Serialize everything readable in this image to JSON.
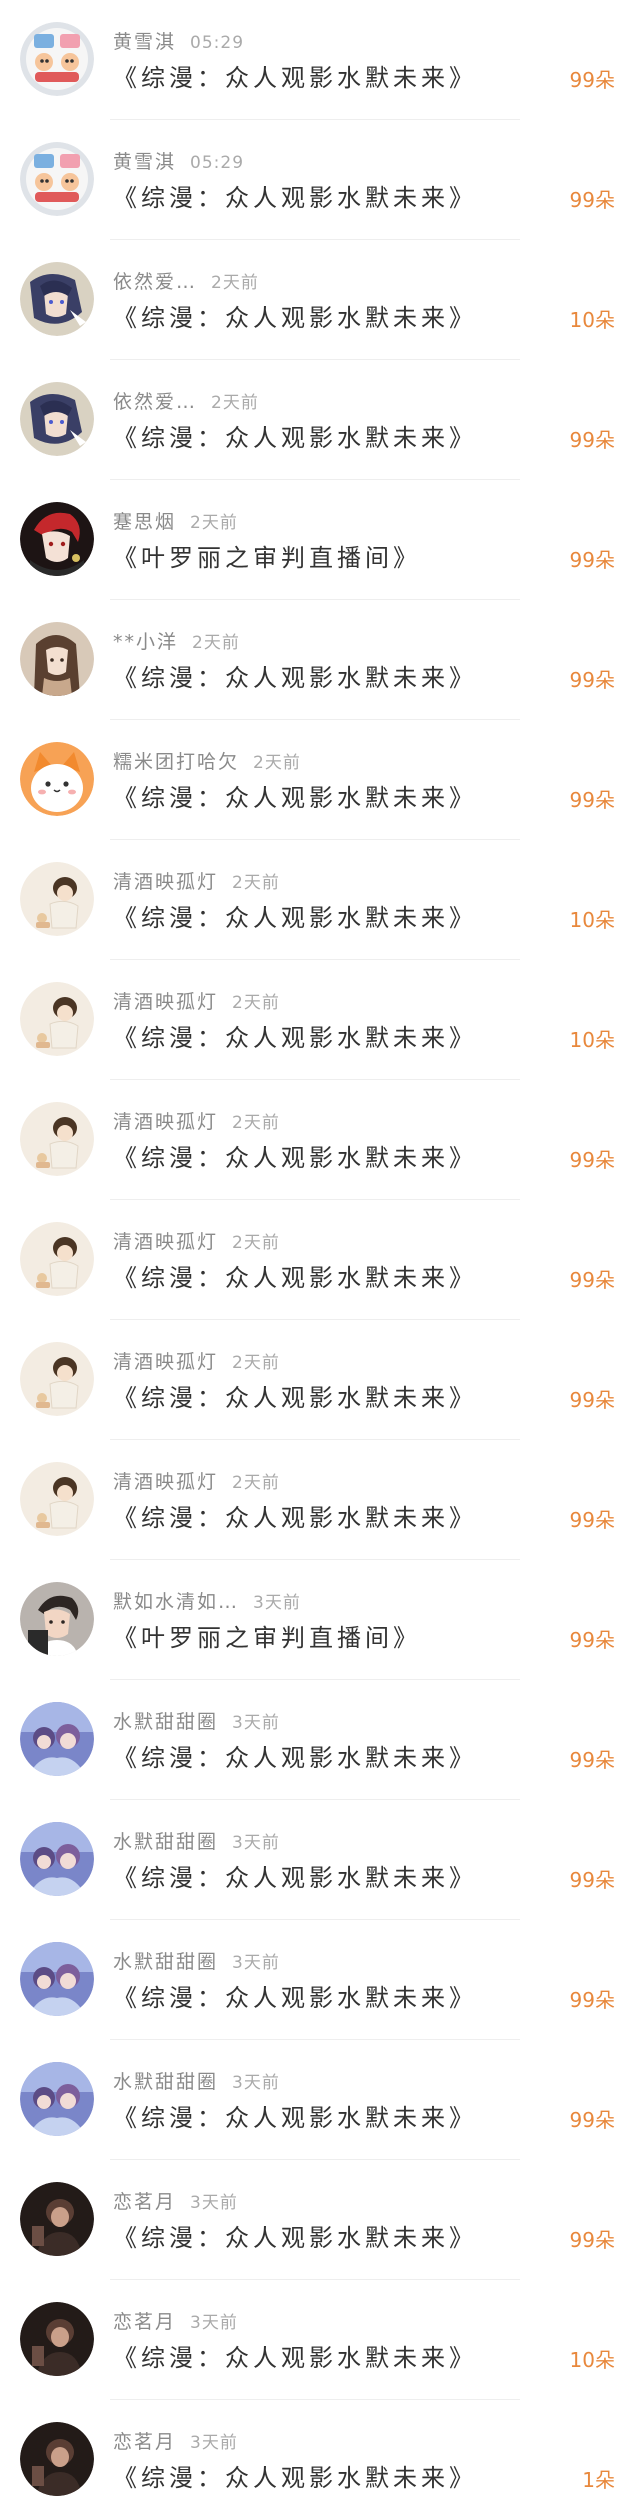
{
  "gift_records": [
    {
      "user": "黄雪淇",
      "time": "05:29",
      "room": "《综漫：众人观影水默未来》",
      "count": "99朵",
      "avatar": "cartoon-sticker-avatar"
    },
    {
      "user": "黄雪淇",
      "time": "05:29",
      "room": "《综漫：众人观影水默未来》",
      "count": "99朵",
      "avatar": "cartoon-sticker-avatar"
    },
    {
      "user": "依然爱…",
      "time": "2天前",
      "room": "《综漫：众人观影水默未来》",
      "count": "10朵",
      "avatar": "anime-character-avatar"
    },
    {
      "user": "依然爱…",
      "time": "2天前",
      "room": "《综漫：众人观影水默未来》",
      "count": "99朵",
      "avatar": "anime-character-avatar"
    },
    {
      "user": "蹇思烟",
      "time": "2天前",
      "room": "《叶罗丽之审判直播间》",
      "count": "99朵",
      "avatar": "red-hair-anime-avatar"
    },
    {
      "user": "**小洋",
      "time": "2天前",
      "room": "《综漫：众人观影水默未来》",
      "count": "99朵",
      "avatar": "long-hair-girl-avatar"
    },
    {
      "user": "糯米团打哈欠",
      "time": "2天前",
      "room": "《综漫：众人观影水默未来》",
      "count": "99朵",
      "avatar": "orange-cat-avatar"
    },
    {
      "user": "清酒映孤灯",
      "time": "2天前",
      "room": "《综漫：众人观影水默未来》",
      "count": "10朵",
      "avatar": "chibi-boy-avatar"
    },
    {
      "user": "清酒映孤灯",
      "time": "2天前",
      "room": "《综漫：众人观影水默未来》",
      "count": "10朵",
      "avatar": "chibi-boy-avatar"
    },
    {
      "user": "清酒映孤灯",
      "time": "2天前",
      "room": "《综漫：众人观影水默未来》",
      "count": "99朵",
      "avatar": "chibi-boy-avatar"
    },
    {
      "user": "清酒映孤灯",
      "time": "2天前",
      "room": "《综漫：众人观影水默未来》",
      "count": "99朵",
      "avatar": "chibi-boy-avatar"
    },
    {
      "user": "清酒映孤灯",
      "time": "2天前",
      "room": "《综漫：众人观影水默未来》",
      "count": "99朵",
      "avatar": "chibi-boy-avatar"
    },
    {
      "user": "清酒映孤灯",
      "time": "2天前",
      "room": "《综漫：众人观影水默未来》",
      "count": "99朵",
      "avatar": "chibi-boy-avatar"
    },
    {
      "user": "默如水清如…",
      "time": "3天前",
      "room": "《叶罗丽之审判直播间》",
      "count": "99朵",
      "avatar": "young-man-photo-avatar"
    },
    {
      "user": "水默甜甜圈",
      "time": "3天前",
      "room": "《综漫：众人观影水默未来》",
      "count": "99朵",
      "avatar": "blue-anime-group-avatar"
    },
    {
      "user": "水默甜甜圈",
      "time": "3天前",
      "room": "《综漫：众人观影水默未来》",
      "count": "99朵",
      "avatar": "blue-anime-group-avatar"
    },
    {
      "user": "水默甜甜圈",
      "time": "3天前",
      "room": "《综漫：众人观影水默未来》",
      "count": "99朵",
      "avatar": "blue-anime-group-avatar"
    },
    {
      "user": "水默甜甜圈",
      "time": "3天前",
      "room": "《综漫：众人观影水默未来》",
      "count": "99朵",
      "avatar": "blue-anime-group-avatar"
    },
    {
      "user": "恋茗月",
      "time": "3天前",
      "room": "《综漫：众人观影水默未来》",
      "count": "99朵",
      "avatar": "dark-portrait-avatar"
    },
    {
      "user": "恋茗月",
      "time": "3天前",
      "room": "《综漫：众人观影水默未来》",
      "count": "10朵",
      "avatar": "dark-portrait-avatar"
    },
    {
      "user": "恋茗月",
      "time": "3天前",
      "room": "《综漫：众人观影水默未来》",
      "count": "1朵",
      "avatar": "dark-portrait-avatar"
    }
  ],
  "colors": {
    "count": "#e8883c",
    "name": "#8a8a8a",
    "time": "#aaaaaa",
    "title": "#333333",
    "divider": "#eeeeee"
  }
}
